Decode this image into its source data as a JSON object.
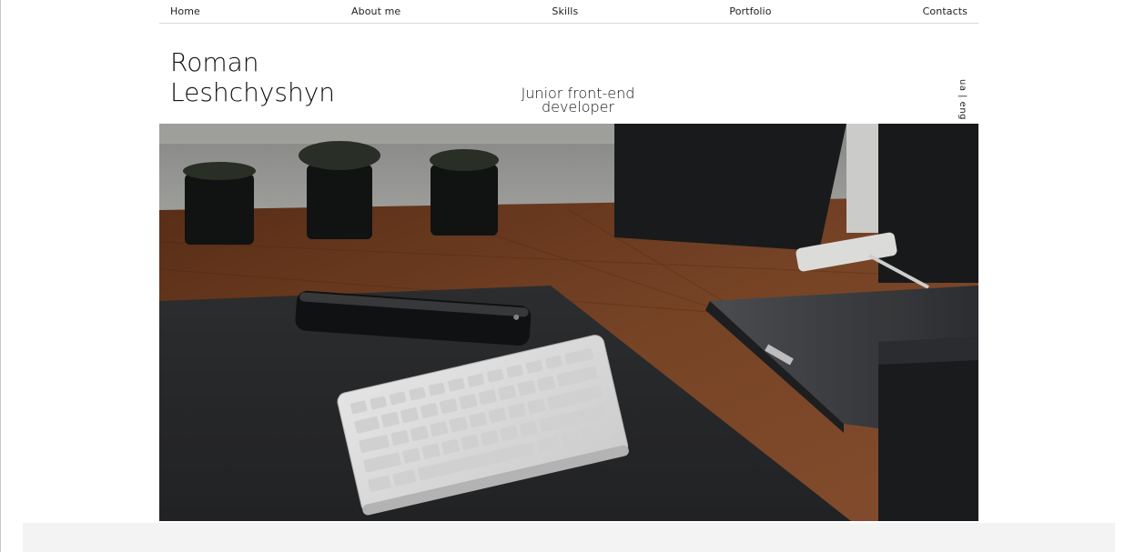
{
  "nav": {
    "items": [
      {
        "label": "Home"
      },
      {
        "label": "About me"
      },
      {
        "label": "Skills"
      },
      {
        "label": "Portfolio"
      },
      {
        "label": "Contacts"
      }
    ]
  },
  "header": {
    "name_first": "Roman",
    "name_last": "Leshchyshyn",
    "role_line1": "Junior front-end",
    "role_line2": "developer",
    "language_switch": "ua | eng"
  },
  "hero": {
    "image_subject": "desk-workspace-photo",
    "colors": {
      "wood": "#7a4426",
      "mat": "#2a2b2d",
      "keyboard": "#e9e9e9",
      "wall": "#9a9a98"
    }
  }
}
